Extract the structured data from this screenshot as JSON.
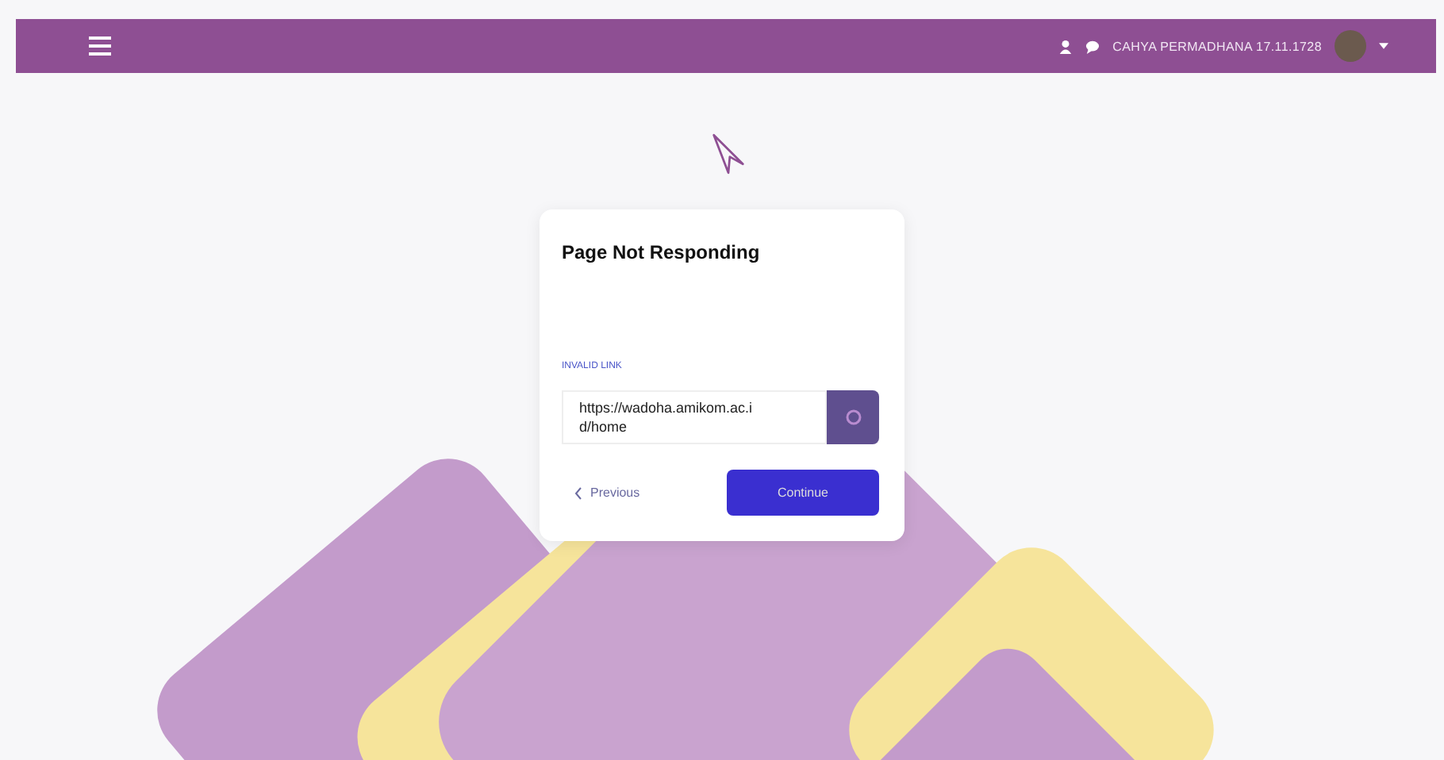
{
  "top_bar": {
    "user_name": "CAHYA PERMADHANA 17.11.1728"
  },
  "dialog": {
    "title": "Page Not Responding",
    "field_label": "INVALID LINK",
    "link_value": "https://wadoha.amikom.ac.id/home",
    "previous_label": "Previous",
    "confirm_label": "Continue"
  }
}
